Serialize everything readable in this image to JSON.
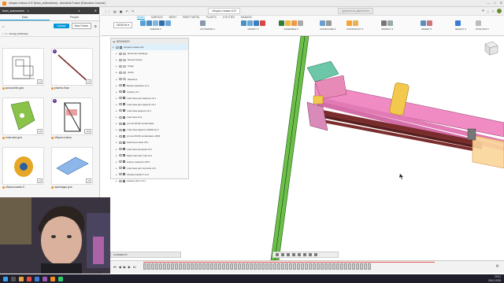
{
  "window": {
    "title": "сборка станка v13* (team_submarines) - Autodesk Fusion (Education License)",
    "minimize": "—",
    "maximize": "□",
    "close": "✕"
  },
  "data_panel": {
    "team": "team_submarines",
    "tabs": [
      "Data",
      "People"
    ],
    "upload_label": "Upload",
    "new_folder_label": "New Folder",
    "breadcrumb": "пилор ревизор",
    "items": [
      {
        "name": "кронштейн для",
        "badge": "v1",
        "num": ""
      },
      {
        "name": "ремень бэкл",
        "badge": "v1",
        "num": "5"
      },
      {
        "name": "пластина для",
        "badge": "v3",
        "num": ""
      },
      {
        "name": "сборка станка",
        "badge": "v13",
        "num": "5"
      },
      {
        "name": "сборка шкива б",
        "badge": "v4",
        "num": ""
      },
      {
        "name": "прокладка для",
        "badge": "v2",
        "num": ""
      }
    ]
  },
  "app_tabs": [
    "сборка станка v13*",
    "держатель двигателя",
    "Untitled",
    "Untitled"
  ],
  "toolbar": {
    "workspace": "DESIGN ▾",
    "tabs": [
      "SOLID",
      "SURFACE",
      "MESH",
      "SHEET METAL",
      "PLASTIC",
      "UTILITIES",
      "MANAGE"
    ],
    "groups": [
      "CREATE ▾",
      "AUTOMATE ▾",
      "MODIFY ▾",
      "ASSEMBLE ▾",
      "CONFIGURE ▾",
      "CONSTRUCT ▾",
      "INSPECT ▾",
      "INSERT ▾",
      "SELECT ▾",
      "POSITION ▾"
    ]
  },
  "browser": {
    "title": "BROWSER",
    "rows": [
      {
        "label": "сборка станка v13",
        "kind": "root"
      },
      {
        "label": "Document Settings",
        "kind": "folder"
      },
      {
        "label": "Named Views",
        "kind": "folder"
      },
      {
        "label": "Origin",
        "kind": "folder"
      },
      {
        "label": "Joints",
        "kind": "folder"
      },
      {
        "label": "Sketches",
        "kind": "folder"
      },
      {
        "label": "Балка профиля v1:1",
        "kind": "comp"
      },
      {
        "label": "трубка v1:1",
        "kind": "comp"
      },
      {
        "label": "пластина для каретки v4:1",
        "kind": "comp"
      },
      {
        "label": "пластина для каретки v4:1",
        "kind": "comp"
      },
      {
        "label": "пластина каретки v3:1",
        "kind": "comp"
      },
      {
        "label": "пластина v3:1",
        "kind": "comp"
      },
      {
        "label": "уголок 40x40 штамповка",
        "kind": "comp"
      },
      {
        "label": "пластина каретки v2(Mirror):1",
        "kind": "comp"
      },
      {
        "label": "уголок 40x40 штамповка v2(Mi",
        "kind": "comp"
      },
      {
        "label": "каретка ролики v5:1",
        "kind": "comp"
      },
      {
        "label": "пластина мотора2 v3:1",
        "kind": "comp"
      },
      {
        "label": "Motor Nema17 L20 v4:1",
        "kind": "comp"
      },
      {
        "label": "корпус зеркала v15:1",
        "kind": "comp"
      },
      {
        "label": "пластина для портала v4:1",
        "kind": "comp"
      },
      {
        "label": "сборка шкива б v4:1",
        "kind": "comp"
      },
      {
        "label": "ремень бэкл v4:1",
        "kind": "comp"
      }
    ]
  },
  "comments_label": "COMMENTS",
  "taskbar": {
    "time": "23:01",
    "date": "28.01.2025"
  },
  "colors": {
    "accent": "#0696d7",
    "fusion_orange": "#f28b24",
    "rail_green": "#6cc04a",
    "pink_tube": "#f08bc3",
    "teal_part": "#6cc7a8"
  }
}
